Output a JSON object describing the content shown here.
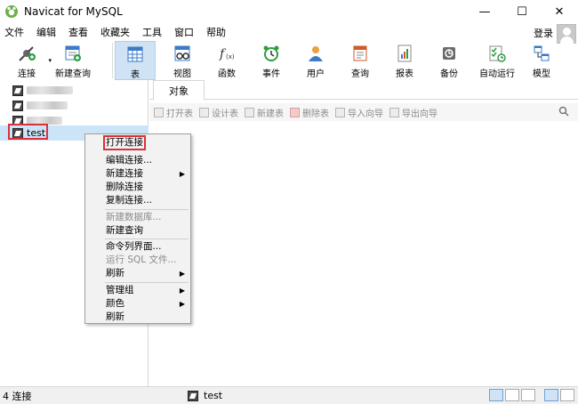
{
  "window": {
    "title": "Navicat for MySQL",
    "minimize": "—",
    "maximize": "☐",
    "close": "✕"
  },
  "menu": [
    "文件",
    "编辑",
    "查看",
    "收藏夹",
    "工具",
    "窗口",
    "帮助"
  ],
  "login_label": "登录",
  "toolbar": [
    {
      "label": "连接",
      "icon": "connect-icon"
    },
    {
      "label": "新建查询",
      "icon": "new-query-icon"
    },
    {
      "label": "表",
      "icon": "table-icon"
    },
    {
      "label": "视图",
      "icon": "view-icon"
    },
    {
      "label": "函数",
      "icon": "function-icon"
    },
    {
      "label": "事件",
      "icon": "event-icon"
    },
    {
      "label": "用户",
      "icon": "user-icon"
    },
    {
      "label": "查询",
      "icon": "query-icon"
    },
    {
      "label": "报表",
      "icon": "report-icon"
    },
    {
      "label": "备份",
      "icon": "backup-icon"
    },
    {
      "label": "自动运行",
      "icon": "auto-run-icon"
    },
    {
      "label": "模型",
      "icon": "model-icon"
    }
  ],
  "connections": {
    "selected_name": "test"
  },
  "tabs": {
    "objects": "对象"
  },
  "object_toolbar": [
    "打开表",
    "设计表",
    "新建表",
    "删除表",
    "导入向导",
    "导出向导"
  ],
  "context_menu": {
    "items": [
      "打开连接",
      "编辑连接...",
      "新建连接",
      "删除连接",
      "复制连接...",
      "新建数据库...",
      "新建查询",
      "命令列界面...",
      "运行 SQL 文件...",
      "刷新",
      "管理组",
      "颜色",
      "刷新"
    ]
  },
  "status": {
    "count": "4 连接",
    "current": "test"
  },
  "colors": {
    "accent": "#cfe3f4",
    "highlight_border": "#d9323a"
  }
}
